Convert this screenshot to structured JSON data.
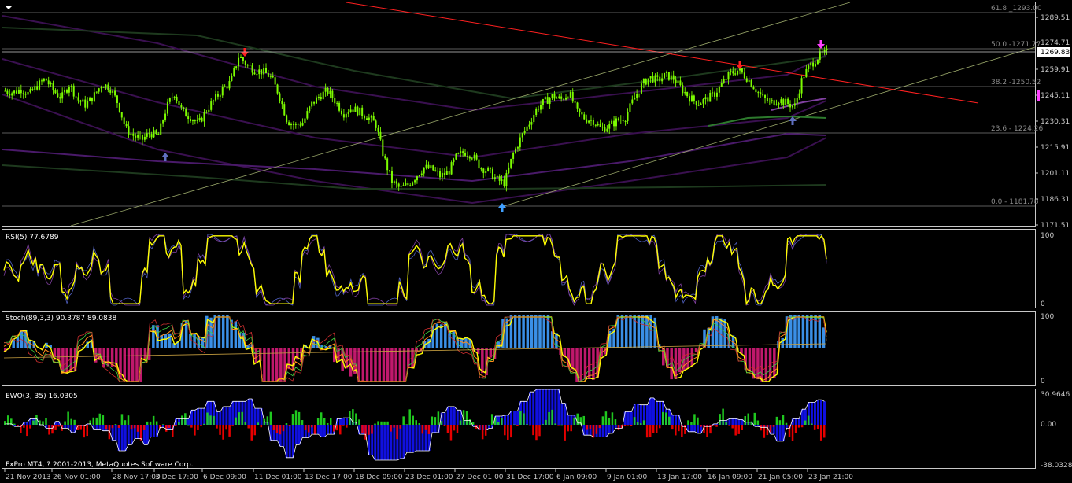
{
  "colors": {
    "background": "#000000",
    "frame": "#c8c8c8",
    "bull_candle": "#7cfc00",
    "trend_red": "#ff2020",
    "rsi_line": "#ffff00",
    "stoch_pos": "#3a8fe6",
    "stoch_neg": "#c0186c",
    "ewo_green": "#22dd22",
    "ewo_blue": "#1010e0",
    "ewo_red": "#ff0000",
    "arrow_down": "#ff2020",
    "arrow_up_blue": "#6070c0",
    "arrow_up_cyan": "#40a0ff",
    "arrow_magenta": "#ff40ff"
  },
  "price_axis": {
    "ticks": [
      "1289.51",
      "1274.71",
      "1259.91",
      "1245.11",
      "1230.31",
      "1215.91",
      "1201.11",
      "1186.31",
      "1171.51"
    ],
    "current_price": "1269.83"
  },
  "fibonacci": [
    {
      "label": "61.8 _1293.00"
    },
    {
      "label": "50.0 -1271.77"
    },
    {
      "label": "38.2 -1250.52"
    },
    {
      "label": "23.6 - 1224.26"
    },
    {
      "label": "0.0 - 1181.78"
    }
  ],
  "rsi": {
    "title": "RSI(5) 77.6789",
    "levels": [
      "100",
      "0"
    ]
  },
  "stoch": {
    "title": "Stoch(89,3,3) 90.3787 89.0838",
    "levels": [
      "100",
      "0"
    ]
  },
  "ewo": {
    "title": "EWO(3, 35) 16.0305",
    "levels": [
      "30.9646",
      "0.00",
      "-38.0328"
    ]
  },
  "copyright": "FxPro MT4, ? 2001-2013, MetaQuotes Software Corp.",
  "time_axis": [
    "21 Nov 2013",
    "26 Nov 01:00",
    "28 Nov 17:00",
    "3 Dec 17:00",
    "6 Dec 09:00",
    "11 Dec 01:00",
    "13 Dec 17:00",
    "18 Dec 09:00",
    "23 Dec 01:00",
    "27 Dec 01:00",
    "31 Dec 17:00",
    "6 Jan 09:00",
    "9 Jan 01:00",
    "13 Jan 17:00",
    "16 Jan 09:00",
    "21 Jan 05:00",
    "23 Jan 21:00"
  ],
  "price_path": [
    1248,
    1247,
    1249,
    1246,
    1251,
    1255,
    1248,
    1244,
    1252,
    1243,
    1240,
    1245,
    1252,
    1250,
    1241,
    1226,
    1222,
    1220,
    1224,
    1222,
    1238,
    1247,
    1236,
    1233,
    1229,
    1237,
    1243,
    1249,
    1253,
    1268,
    1263,
    1260,
    1259,
    1256,
    1246,
    1231,
    1228,
    1230,
    1240,
    1245,
    1248,
    1242,
    1235,
    1238,
    1236,
    1233,
    1229,
    1210,
    1196,
    1192,
    1194,
    1199,
    1204,
    1203,
    1199,
    1201,
    1210,
    1213,
    1211,
    1204,
    1202,
    1197,
    1195,
    1211,
    1221,
    1229,
    1238,
    1242,
    1245,
    1243,
    1247,
    1236,
    1232,
    1231,
    1226,
    1228,
    1231,
    1233,
    1243,
    1251,
    1256,
    1254,
    1257,
    1255,
    1249,
    1244,
    1241,
    1243,
    1246,
    1252,
    1258,
    1260,
    1256,
    1250,
    1244,
    1241,
    1243,
    1241,
    1239,
    1256,
    1263,
    1268,
    1270
  ]
}
